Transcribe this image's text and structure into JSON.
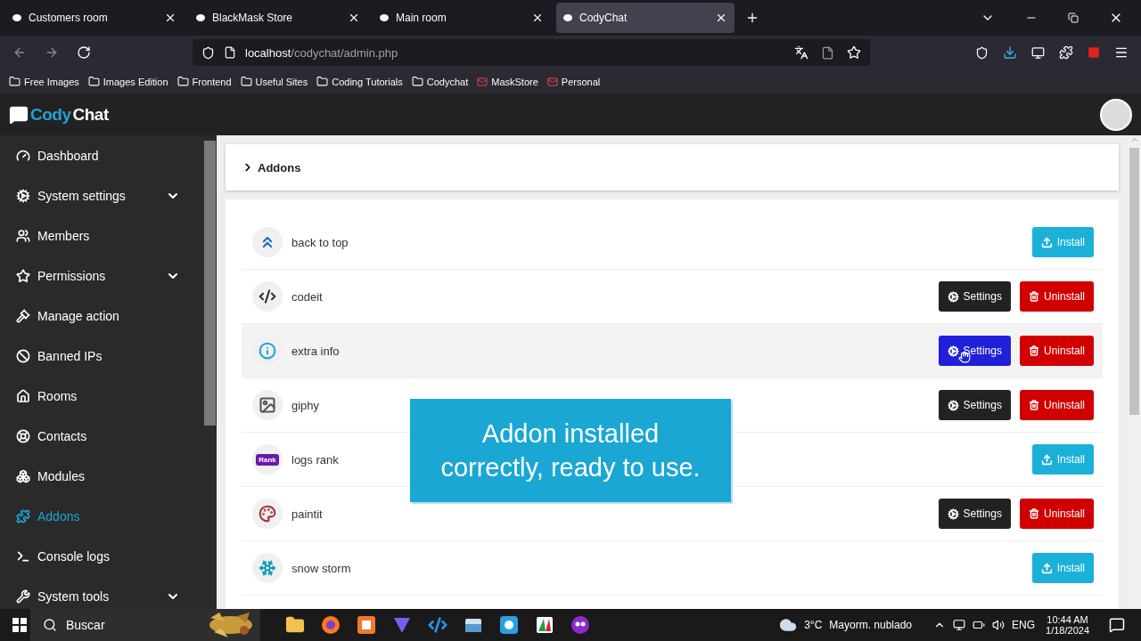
{
  "browser": {
    "tabs": [
      {
        "title": "Customers room",
        "selected": false
      },
      {
        "title": "BlackMask Store",
        "selected": false
      },
      {
        "title": "Main room",
        "selected": false
      },
      {
        "title": "CodyChat",
        "selected": true
      }
    ],
    "address": {
      "host": "localhost",
      "path": "/codychat/admin.php"
    },
    "bookmarks": [
      {
        "label": "Free Images",
        "kind": "folder"
      },
      {
        "label": "Images Edition",
        "kind": "folder"
      },
      {
        "label": "Frontend",
        "kind": "folder"
      },
      {
        "label": "Useful Sites",
        "kind": "folder"
      },
      {
        "label": "Coding Tutorials",
        "kind": "folder"
      },
      {
        "label": "Codychat",
        "kind": "folder"
      },
      {
        "label": "MaskStore",
        "kind": "mail"
      },
      {
        "label": "Personal",
        "kind": "mail"
      }
    ]
  },
  "app": {
    "logo": {
      "first": "Cody",
      "second": "Chat"
    },
    "sidebar": [
      {
        "label": "Dashboard",
        "expandable": false,
        "selected": false
      },
      {
        "label": "System settings",
        "expandable": true,
        "selected": false
      },
      {
        "label": "Members",
        "expandable": false,
        "selected": false
      },
      {
        "label": "Permissions",
        "expandable": true,
        "selected": false
      },
      {
        "label": "Manage action",
        "expandable": false,
        "selected": false
      },
      {
        "label": "Banned IPs",
        "expandable": false,
        "selected": false
      },
      {
        "label": "Rooms",
        "expandable": false,
        "selected": false
      },
      {
        "label": "Contacts",
        "expandable": false,
        "selected": false
      },
      {
        "label": "Modules",
        "expandable": false,
        "selected": false
      },
      {
        "label": "Addons",
        "expandable": false,
        "selected": true
      },
      {
        "label": "Console logs",
        "expandable": false,
        "selected": false
      },
      {
        "label": "System tools",
        "expandable": true,
        "selected": false
      }
    ],
    "page_title": "Addons",
    "addons": [
      {
        "name": "back to top",
        "hovered": false,
        "buttons": [
          {
            "kind": "install",
            "label": "Install"
          }
        ]
      },
      {
        "name": "codeit",
        "hovered": false,
        "buttons": [
          {
            "kind": "settings",
            "label": "Settings"
          },
          {
            "kind": "uninstall",
            "label": "Uninstall"
          }
        ]
      },
      {
        "name": "extra info",
        "hovered": true,
        "buttons": [
          {
            "kind": "settings",
            "label": "Settings"
          },
          {
            "kind": "uninstall",
            "label": "Uninstall"
          }
        ]
      },
      {
        "name": "giphy",
        "hovered": false,
        "buttons": [
          {
            "kind": "settings",
            "label": "Settings"
          },
          {
            "kind": "uninstall",
            "label": "Uninstall"
          }
        ]
      },
      {
        "name": "logs rank",
        "hovered": false,
        "badge": "Rank",
        "buttons": [
          {
            "kind": "install",
            "label": "Install"
          }
        ]
      },
      {
        "name": "paintit",
        "hovered": false,
        "buttons": [
          {
            "kind": "settings",
            "label": "Settings"
          },
          {
            "kind": "uninstall",
            "label": "Uninstall"
          }
        ]
      },
      {
        "name": "snow storm",
        "hovered": false,
        "buttons": [
          {
            "kind": "install",
            "label": "Install"
          }
        ]
      }
    ],
    "caption": "Addon installed correctly, ready to use."
  },
  "taskbar": {
    "search": "Buscar",
    "temperature": "3°C",
    "weather": "Mayorm. nublado",
    "language": "ENG",
    "time": "10:44 AM",
    "date": "1/18/2024"
  }
}
